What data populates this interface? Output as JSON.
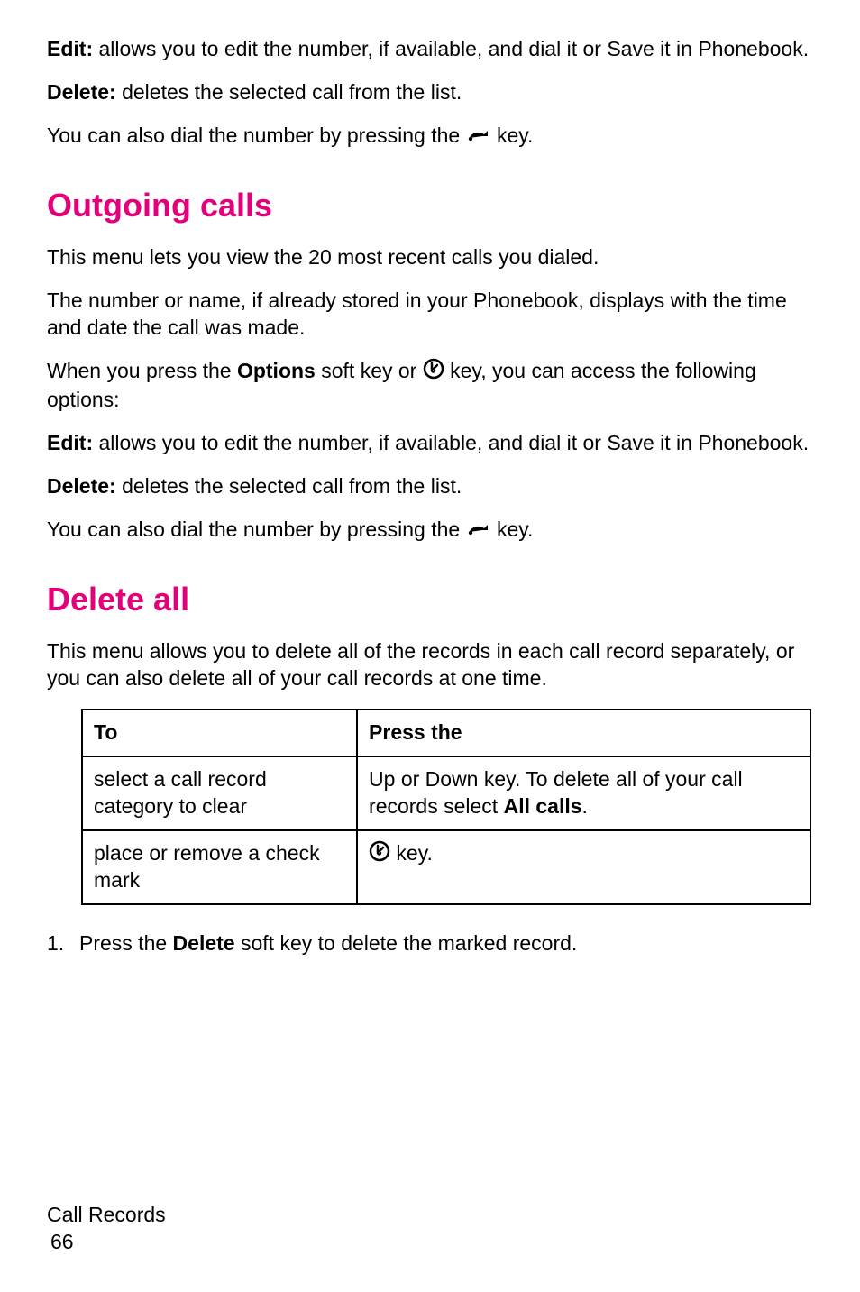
{
  "p1_edit": {
    "label": "Edit:",
    "text": " allows you to edit the number, if available, and dial it or Save it in Phonebook."
  },
  "p1_delete": {
    "label": "Delete:",
    "text": " deletes the selected call from the list."
  },
  "p1_dial": {
    "pre": "You can also dial the number by pressing the ",
    "post": " key."
  },
  "h_outgoing": "Outgoing calls",
  "p2_intro": "This menu lets you view the 20 most recent calls you dialed.",
  "p2_num": "The number or name, if already stored in your Phonebook, displays with the time and date the call was made.",
  "p2_opt": {
    "pre": "When you press the ",
    "bold": "Options",
    "mid": " soft key or ",
    "post": "  key, you can access the following options:"
  },
  "p2_edit": {
    "label": "Edit:",
    "text": " allows you to edit the number, if available, and dial it or Save it in Phonebook."
  },
  "p2_delete": {
    "label": "Delete:",
    "text": " deletes the selected call from the list."
  },
  "p2_dial": {
    "pre": "You can also dial the number by pressing the ",
    "post": " key."
  },
  "h_deleteall": "Delete all",
  "p3_intro": "This menu allows you to delete all of the records in each call record separately, or you can also delete all of your call records at one time.",
  "table": {
    "h1": "To",
    "h2": "Press the",
    "r1c1": "select a call record category to clear",
    "r1c2_pre": "Up or Down key. To delete all of your call records select ",
    "r1c2_bold": "All calls",
    "r1c2_post": ".",
    "r2c1": "place or remove a check mark",
    "r2c2": " key."
  },
  "step1": {
    "num": "1.",
    "pre": "Press the ",
    "bold": "Delete",
    "post": " soft key to delete the marked record."
  },
  "footer": {
    "section": "Call Records",
    "page": "66"
  }
}
